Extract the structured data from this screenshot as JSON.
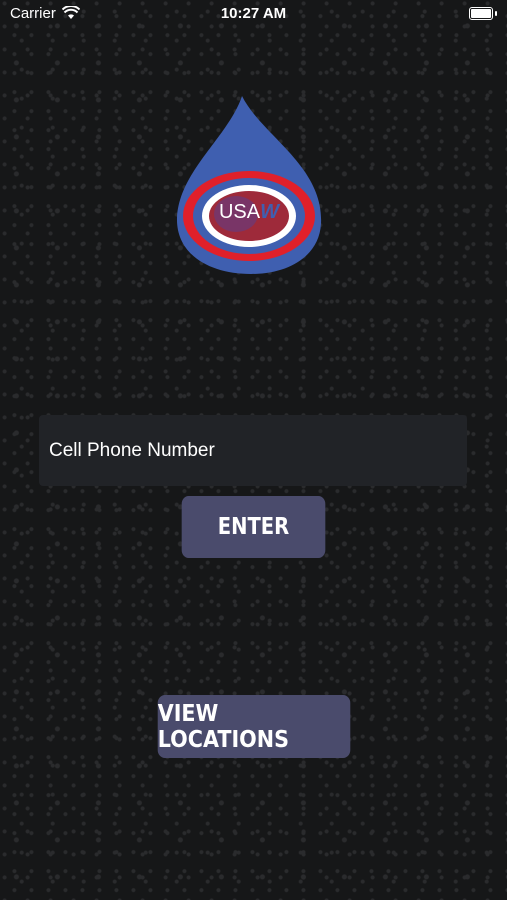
{
  "status_bar": {
    "carrier": "Carrier",
    "time": "10:27 AM"
  },
  "logo": {
    "text_primary": "USA",
    "text_accent": "W",
    "colors": {
      "drop": "#3f5fb0",
      "ring_red": "#e0202a",
      "ring_white": "#ffffff"
    }
  },
  "phone_input": {
    "placeholder": "Cell Phone Number",
    "value": ""
  },
  "buttons": {
    "enter": "ENTER",
    "view_locations": "VIEW LOCATIONS"
  },
  "colors": {
    "button_bg": "#4a4b6c",
    "input_bg": "#212327"
  }
}
